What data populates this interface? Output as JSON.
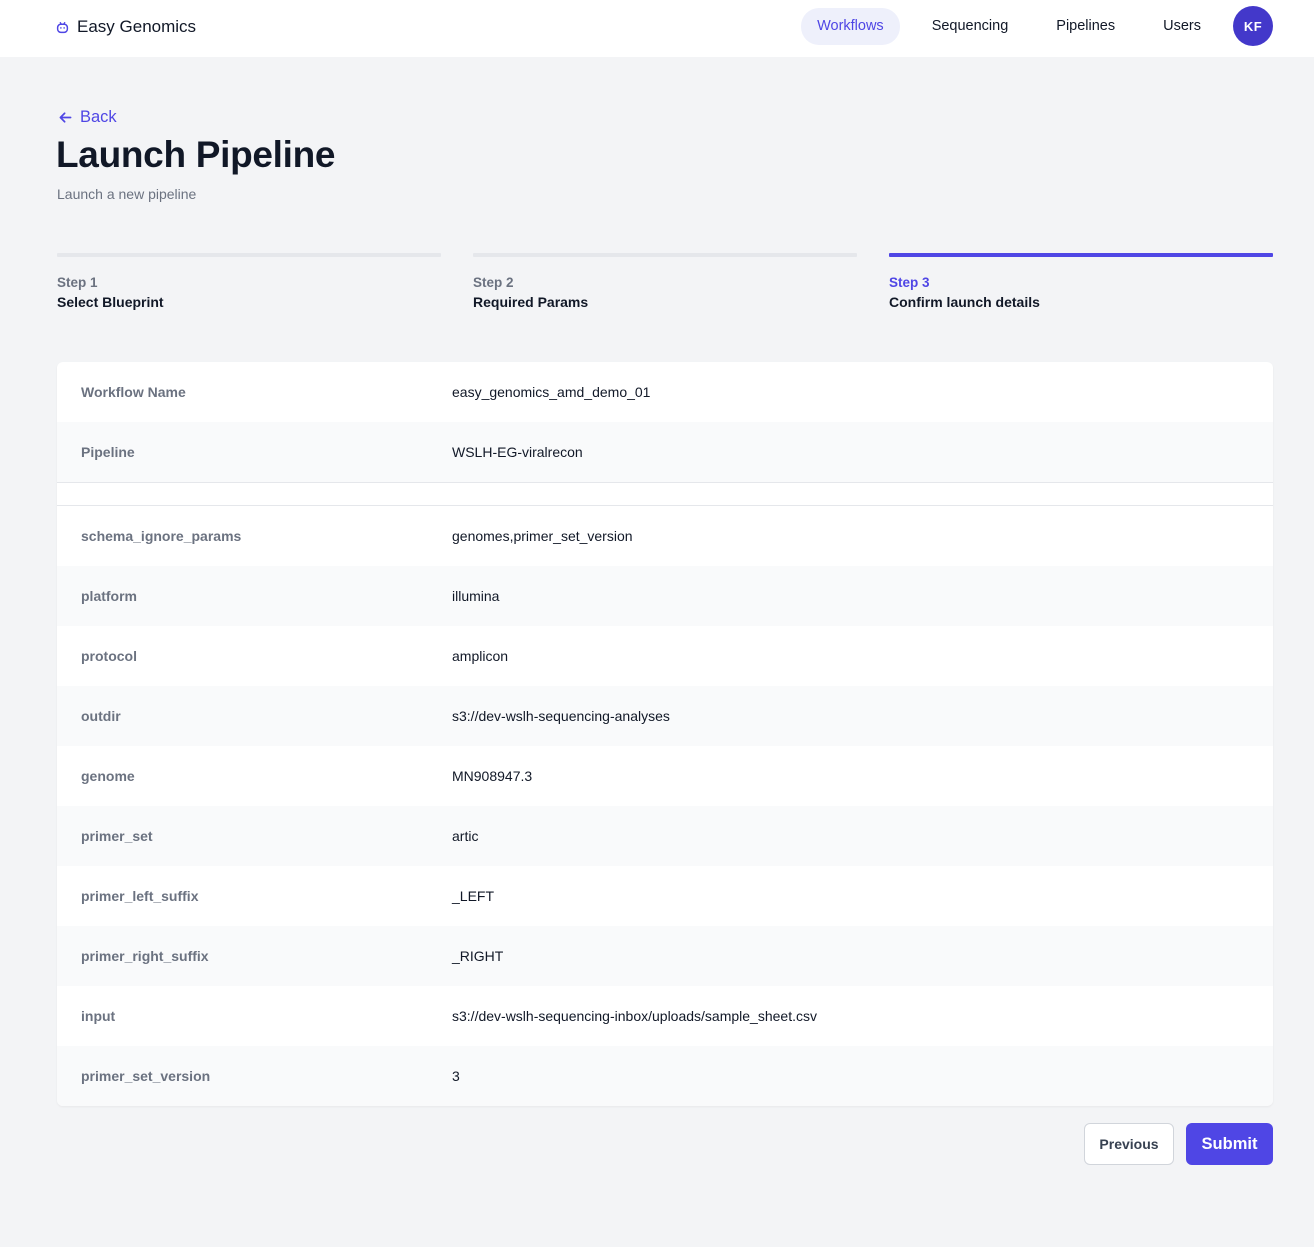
{
  "header": {
    "brand": "Easy Genomics",
    "brand_icon": "bug-icon",
    "nav": [
      {
        "label": "Workflows",
        "active": true
      },
      {
        "label": "Sequencing",
        "active": false
      },
      {
        "label": "Pipelines",
        "active": false
      },
      {
        "label": "Users",
        "active": false
      }
    ],
    "avatar_initials": "KF"
  },
  "page": {
    "back_label": "Back",
    "title": "Launch Pipeline",
    "subtitle": "Launch a new pipeline"
  },
  "stepper": {
    "current_step": 3,
    "steps": [
      {
        "number": "Step 1",
        "name": "Select Blueprint"
      },
      {
        "number": "Step 2",
        "name": "Required Params"
      },
      {
        "number": "Step 3",
        "name": "Confirm launch details"
      }
    ]
  },
  "details": {
    "summary": [
      {
        "label": "Workflow Name",
        "value": "easy_genomics_amd_demo_01"
      },
      {
        "label": "Pipeline",
        "value": "WSLH-EG-viralrecon"
      }
    ],
    "params": [
      {
        "label": "schema_ignore_params",
        "value": "genomes,primer_set_version"
      },
      {
        "label": "platform",
        "value": "illumina"
      },
      {
        "label": "protocol",
        "value": "amplicon"
      },
      {
        "label": "outdir",
        "value": "s3://dev-wslh-sequencing-analyses"
      },
      {
        "label": "genome",
        "value": "MN908947.3"
      },
      {
        "label": "primer_set",
        "value": "artic"
      },
      {
        "label": "primer_left_suffix",
        "value": "_LEFT"
      },
      {
        "label": "primer_right_suffix",
        "value": "_RIGHT"
      },
      {
        "label": "input",
        "value": "s3://dev-wslh-sequencing-inbox/uploads/sample_sheet.csv"
      },
      {
        "label": "primer_set_version",
        "value": "3"
      }
    ]
  },
  "actions": {
    "previous_label": "Previous",
    "submit_label": "Submit"
  },
  "colors": {
    "accent": "#4f46e5",
    "background": "#f3f4f6",
    "card": "#ffffff"
  }
}
